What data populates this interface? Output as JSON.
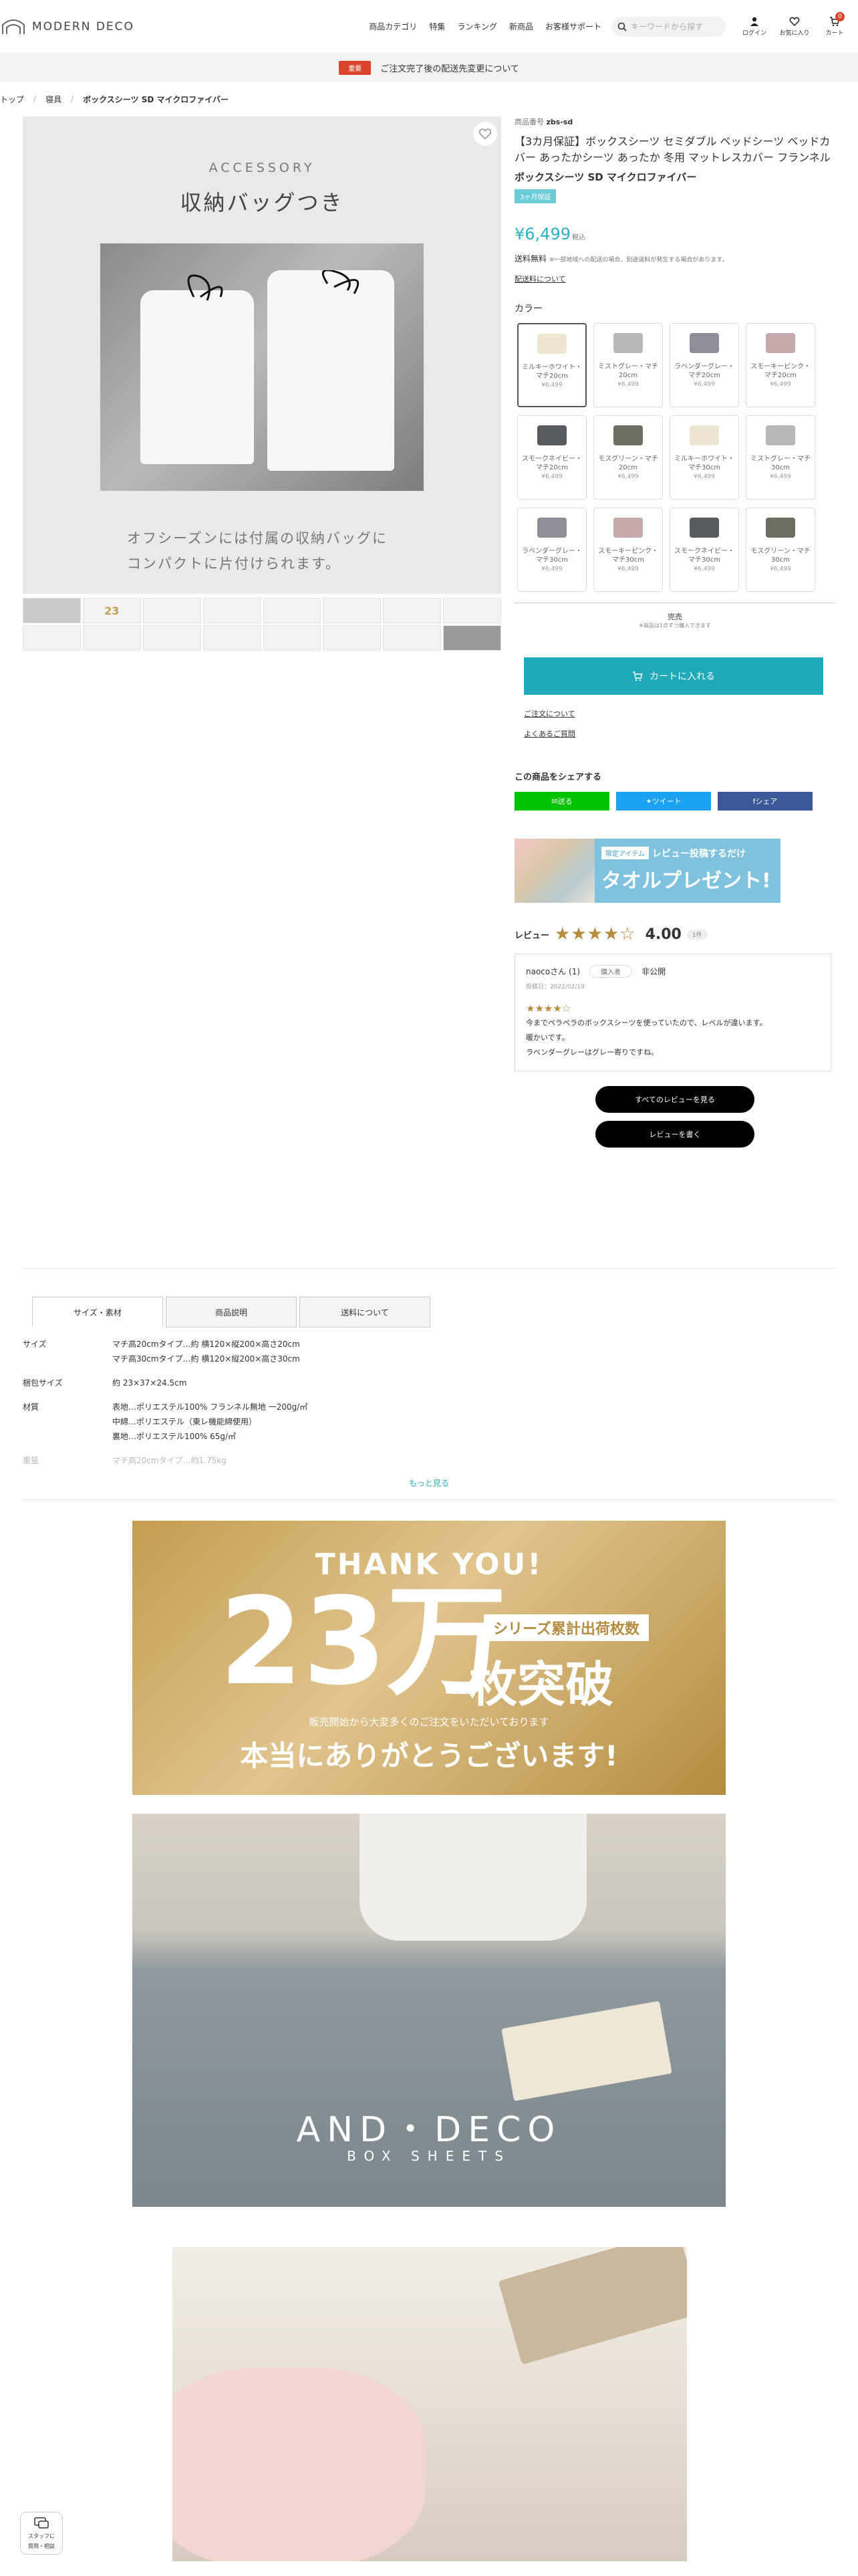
{
  "header": {
    "brand": "MODERN DECO",
    "nav": [
      "商品カテゴリ",
      "特集",
      "ランキング",
      "新商品",
      "お客様サポート"
    ],
    "search_placeholder": "キーワードから探す",
    "icons": [
      {
        "icon": "user-icon",
        "label": "ログイン"
      },
      {
        "icon": "heart-icon",
        "label": "お気に入り"
      },
      {
        "icon": "cart-icon",
        "label": "カート"
      }
    ],
    "cart_count": "0"
  },
  "notice": {
    "badge": "重要",
    "text": "ご注文完了後の配送先変更について"
  },
  "breadcrumb": [
    "トップ",
    "寝具",
    "ボックスシーツ SD マイクロファイバー"
  ],
  "gallery": {
    "heading": "ACCESSORY",
    "subheading": "収納バッグつき",
    "caption_line1": "オフシーズンには付属の収納バッグに",
    "caption_line2": "コンパクトに片付けられます。",
    "thumbs": [
      "",
      "23",
      "",
      "",
      "",
      "",
      "",
      "",
      "",
      "",
      "",
      "",
      "",
      "",
      "",
      ""
    ]
  },
  "product": {
    "number_label": "商品番号",
    "number": "zbs-sd",
    "title": "【3カ月保証】ボックスシーツ セミダブル ベッドシーツ ベッドカバー あったかシーツ あったか 冬用 マットレスカバー フランネル",
    "name": "ボックスシーツ SD マイクロファイバー",
    "tag": "3ヶ月保証",
    "price": "¥6,499",
    "tax": "税込",
    "shipping": "送料無料",
    "shipping_note": "※一部地域への配送の場合、別途送料が発生する場合があります。",
    "delivery_link": "配送料について",
    "color_label": "カラー",
    "colors": [
      {
        "name": "ミルキーホワイト・マチ20cm",
        "price": "¥6,499",
        "hex": "#eee6d3",
        "selected": true
      },
      {
        "name": "ミストグレー・マチ20cm",
        "price": "¥6,499",
        "hex": "#b7b9b7",
        "selected": false
      },
      {
        "name": "ラベンダーグレー・マチ20cm",
        "price": "¥6,499",
        "hex": "#8e8d98",
        "selected": false
      },
      {
        "name": "スモーキーピンク・マチ20cm",
        "price": "¥6,499",
        "hex": "#c6a9aa",
        "selected": false
      },
      {
        "name": "スモークネイビー・マチ20cm",
        "price": "¥6,499",
        "hex": "#56595e",
        "selected": false
      },
      {
        "name": "モスグリーン・マチ20cm",
        "price": "¥6,499",
        "hex": "#6b6e5e",
        "selected": false
      },
      {
        "name": "ミルキーホワイト・マチ30cm",
        "price": "¥6,499",
        "hex": "#eee6d3",
        "selected": false
      },
      {
        "name": "ミストグレー・マチ30cm",
        "price": "¥6,499",
        "hex": "#b7b9b7",
        "selected": false
      },
      {
        "name": "ラベンダーグレー・マチ30cm",
        "price": "¥6,499",
        "hex": "#8e8d98",
        "selected": false
      },
      {
        "name": "スモーキーピンク・マチ30cm",
        "price": "¥6,499",
        "hex": "#c6a9aa",
        "selected": false
      },
      {
        "name": "スモークネイビー・マチ30cm",
        "price": "¥6,499",
        "hex": "#56595e",
        "selected": false
      },
      {
        "name": "モスグリーン・マチ30cm",
        "price": "¥6,499",
        "hex": "#6b6e5e",
        "selected": false
      }
    ],
    "stock": "完売",
    "stock_note": "※商品は1点ずつ購入できます",
    "cart_button": "カートに入れる",
    "order_link": "ご注文について",
    "faq_link": "よくあるご質問"
  },
  "share": {
    "title": "この商品をシェアする",
    "buttons": [
      {
        "label": "送る",
        "color": "#00c300"
      },
      {
        "label": "ツイート",
        "color": "#1da1f2"
      },
      {
        "label": "シェア",
        "color": "#3b5998"
      }
    ]
  },
  "banner": {
    "badge": "限定アイテム",
    "line1": "レビュー投稿するだけ",
    "line2": "タオルプレゼント!"
  },
  "reviews": {
    "label": "レビュー",
    "stars": "★★★★☆",
    "score": "4.00",
    "count": "1件",
    "user": "naocoさん (1)",
    "badge": "購入者",
    "privacy": "非公開",
    "date": "投稿日：2022/02/19",
    "rating": "★★★★☆",
    "text": [
      "今までペラペラのボックスシーツを使っていたので、レベルが違います。",
      "暖かいです。",
      "ラベンダーグレーはグレー寄りですね。"
    ],
    "all_button": "すべてのレビューを見る",
    "write_button": "レビューを書く"
  },
  "tabs": {
    "items": [
      "サイズ・素材",
      "商品説明",
      "送料について"
    ],
    "specs": [
      {
        "key": "サイズ",
        "lines": [
          "マチ高20cmタイプ…約 横120×縦200×高さ20cm",
          "マチ高30cmタイプ…約 横120×縦200×高さ30cm"
        ]
      },
      {
        "key": "梱包サイズ",
        "lines": [
          "約 23×37×24.5cm"
        ]
      },
      {
        "key": "材質",
        "lines": [
          "表地…ポリエステル100% フランネル無地 一200g/㎡",
          "中綿…ポリエステル（東レ機能綿使用）",
          "裏地…ポリエステル100% 65g/㎡"
        ]
      },
      {
        "key": "重量",
        "lines": [
          "マチ高20cmタイプ…約1.75kg"
        ]
      }
    ],
    "more": "もっと見る"
  },
  "thanks": {
    "line1": "THANK YOU!",
    "number": "23万",
    "badge": "シリーズ累計出荷枚数",
    "suffix": "枚突破",
    "sub": "販売開始から大変多くのご注文をいただいております",
    "main": "本当にありがとうございます!"
  },
  "photo1": {
    "brand": "AND・DECO",
    "subbrand": "BOX SHEETS"
  },
  "chat": {
    "label1": "スタッフに",
    "label2": "質問・相談"
  }
}
